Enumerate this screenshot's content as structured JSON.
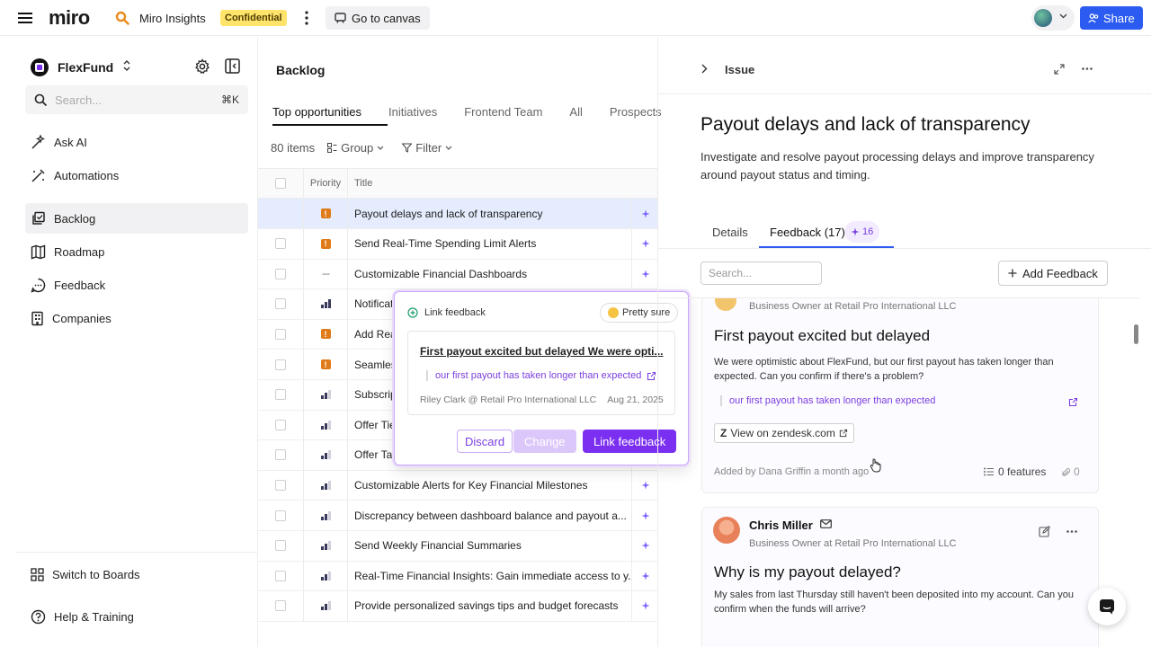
{
  "topbar": {
    "logo": "miro",
    "app_name": "Miro Insights",
    "confidential": "Confidential",
    "go_to_canvas": "Go to canvas",
    "share": "Share"
  },
  "sidebar": {
    "workspace": "FlexFund",
    "search_placeholder": "Search...",
    "search_shortcut": "⌘K",
    "items": [
      {
        "label": "Ask AI"
      },
      {
        "label": "Automations"
      },
      {
        "label": "Backlog"
      },
      {
        "label": "Roadmap"
      },
      {
        "label": "Feedback"
      },
      {
        "label": "Companies"
      }
    ],
    "switch_boards": "Switch to Boards",
    "help": "Help & Training"
  },
  "backlog": {
    "title": "Backlog",
    "tabs": [
      "Top opportunities",
      "Initiatives",
      "Frontend Team",
      "All",
      "Prospects"
    ],
    "items_count": "80 items",
    "group_label": "Group",
    "filter_label": "Filter",
    "col_priority": "Priority",
    "col_title": "Title",
    "rows": [
      {
        "priority": "urgent",
        "title": "Payout delays and lack of transparency"
      },
      {
        "priority": "urgent",
        "title": "Send Real-Time Spending Limit Alerts"
      },
      {
        "priority": "none",
        "title": "Customizable Financial Dashboards"
      },
      {
        "priority": "high",
        "title": "Notifications for Upcoming Payouts"
      },
      {
        "priority": "urgent",
        "title": "Add Real-Time Payout Tracking"
      },
      {
        "priority": "urgent",
        "title": "Seamless Bank Account Linking"
      },
      {
        "priority": "medium",
        "title": "Subscription Management Tools"
      },
      {
        "priority": "medium",
        "title": "Offer Tiered Cashback Rewards"
      },
      {
        "priority": "medium",
        "title": "Offer Tax Reporting Exports"
      },
      {
        "priority": "medium",
        "title": "Customizable Alerts for Key Financial Milestones"
      },
      {
        "priority": "medium",
        "title": "Discrepancy between dashboard balance and payout a..."
      },
      {
        "priority": "medium",
        "title": "Send Weekly Financial Summaries"
      },
      {
        "priority": "medium",
        "title": "Real-Time Financial Insights: Gain immediate access to y..."
      },
      {
        "priority": "medium",
        "title": "Provide personalized savings tips and budget forecasts"
      }
    ]
  },
  "popover": {
    "title": "Link feedback",
    "confidence": "Pretty sure",
    "feedback_title": "First payout excited but delayed We were opti...",
    "quote": "our first payout has taken longer than expected",
    "meta_author": "Riley Clark @ Retail Pro International LLC",
    "meta_date": "Aug 21, 2025",
    "discard": "Discard",
    "change": "Change",
    "link": "Link feedback"
  },
  "issue": {
    "breadcrumb": "Issue",
    "title": "Payout delays and lack of transparency",
    "description": "Investigate and resolve payout processing delays and improve transparency around payout status and timing.",
    "tab_details": "Details",
    "tab_feedback": "Feedback (17)",
    "ai_count": "16",
    "search_placeholder": "Search...",
    "add_feedback": "Add Feedback",
    "cards": [
      {
        "role": "Business Owner at Retail Pro International LLC",
        "title": "First payout excited but delayed",
        "body": "We were optimistic about FlexFund, but our first payout has taken longer than expected. Can you confirm if there's a problem?",
        "quote": "our first payout has taken longer than expected",
        "source": "View on zendesk.com",
        "added": "Added by Dana Griffin a month ago",
        "features": "0 features",
        "attachments": "0"
      },
      {
        "name": "Chris Miller",
        "role": "Business Owner at Retail Pro International LLC",
        "title": "Why is my payout delayed?",
        "body": "My sales from last Thursday still haven't been deposited into my account. Can you confirm when the funds will arrive?"
      }
    ]
  },
  "colors": {
    "accent": "#2b5bf0",
    "purple": "#7b2ff0",
    "urgent": "#e07b1a"
  }
}
